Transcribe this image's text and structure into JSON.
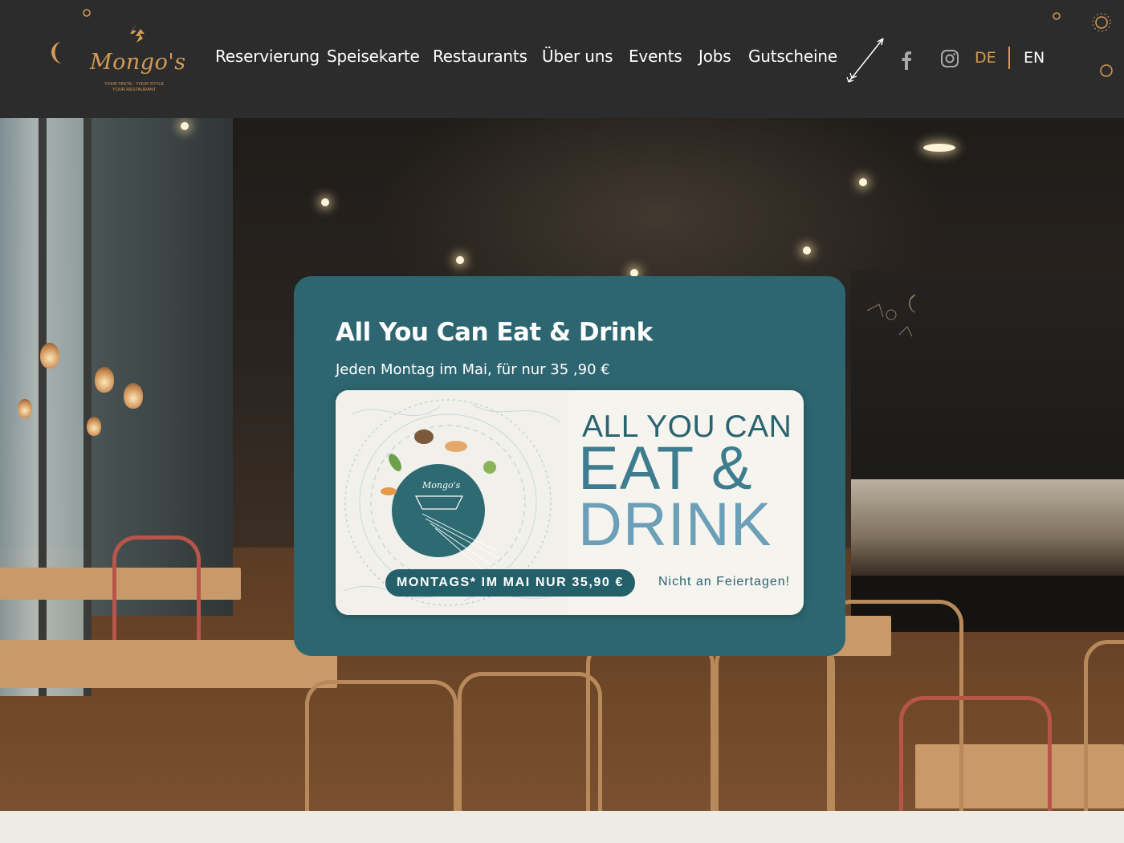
{
  "brand": {
    "name": "Mongo's",
    "tagline_line1": "YOUR TASTE · YOUR STYLE",
    "tagline_line2": "YOUR RESTAURANT"
  },
  "nav": {
    "items": [
      {
        "label": "Reservierung"
      },
      {
        "label": "Speisekarte"
      },
      {
        "label": "Restaurants"
      },
      {
        "label": "Über uns"
      },
      {
        "label": "Events"
      },
      {
        "label": "Jobs"
      },
      {
        "label": "Gutscheine"
      }
    ]
  },
  "social": {
    "facebook_icon": "facebook-icon",
    "instagram_icon": "instagram-icon"
  },
  "lang": {
    "active": "DE",
    "other": "EN",
    "active_color": "#d39b55"
  },
  "promo": {
    "title": "All You Can Eat & Drink",
    "subtitle": "Jeden Montag im Mai, für nur 35 ,90 €",
    "banner": {
      "line1": "ALL YOU CAN",
      "line2": "EAT &",
      "line3": "DRINK",
      "logo": "Mongo's",
      "pill": "MONTAGS* IM MAI  NUR 35,90 €",
      "note": "Nicht an Feiertagen!"
    },
    "background_color": "#2d6670"
  },
  "colors": {
    "header_bg": "#2d2c2c",
    "accent_gold": "#d39b55",
    "teal": "#2d6670"
  }
}
